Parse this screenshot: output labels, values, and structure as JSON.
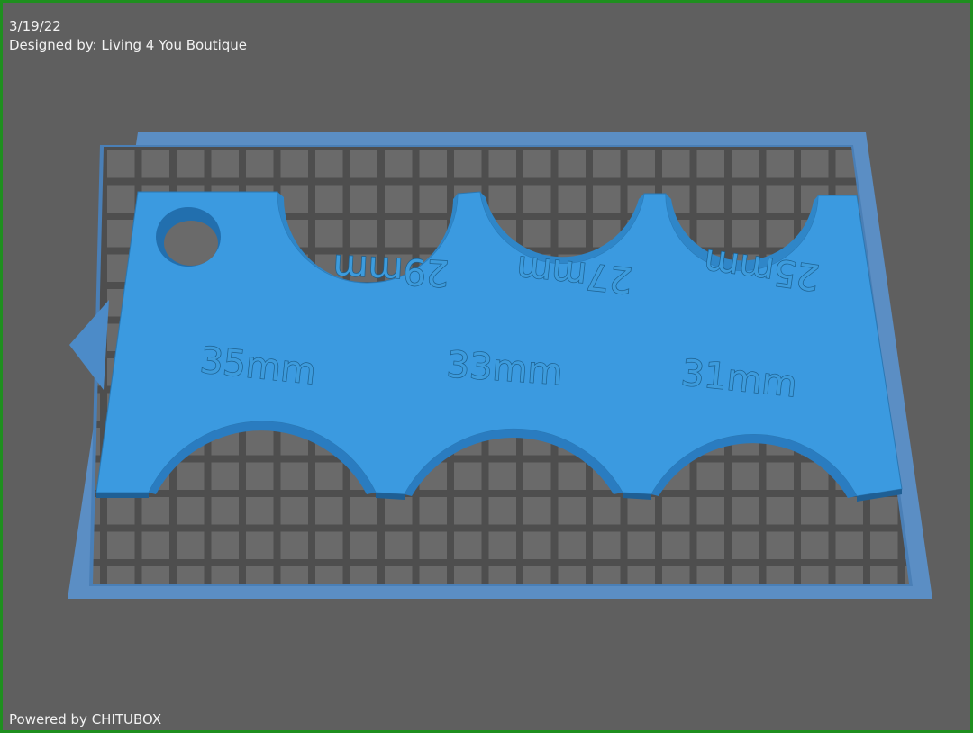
{
  "header": {
    "date": "3/19/22",
    "designer": "Designed by: Living 4 You Boutique"
  },
  "footer": {
    "powered_by": "Powered by CHITUBOX"
  },
  "model": {
    "top_labels": [
      "29mm",
      "27mm",
      "25mm"
    ],
    "bottom_labels": [
      "35mm",
      "33mm",
      "31mm"
    ]
  },
  "colors": {
    "frame": "#1f8f1f",
    "background": "#5f5f5f",
    "plate": "#5b8ec4",
    "grid_cell": "#6b6b6b",
    "model": "#3d9bdc"
  }
}
